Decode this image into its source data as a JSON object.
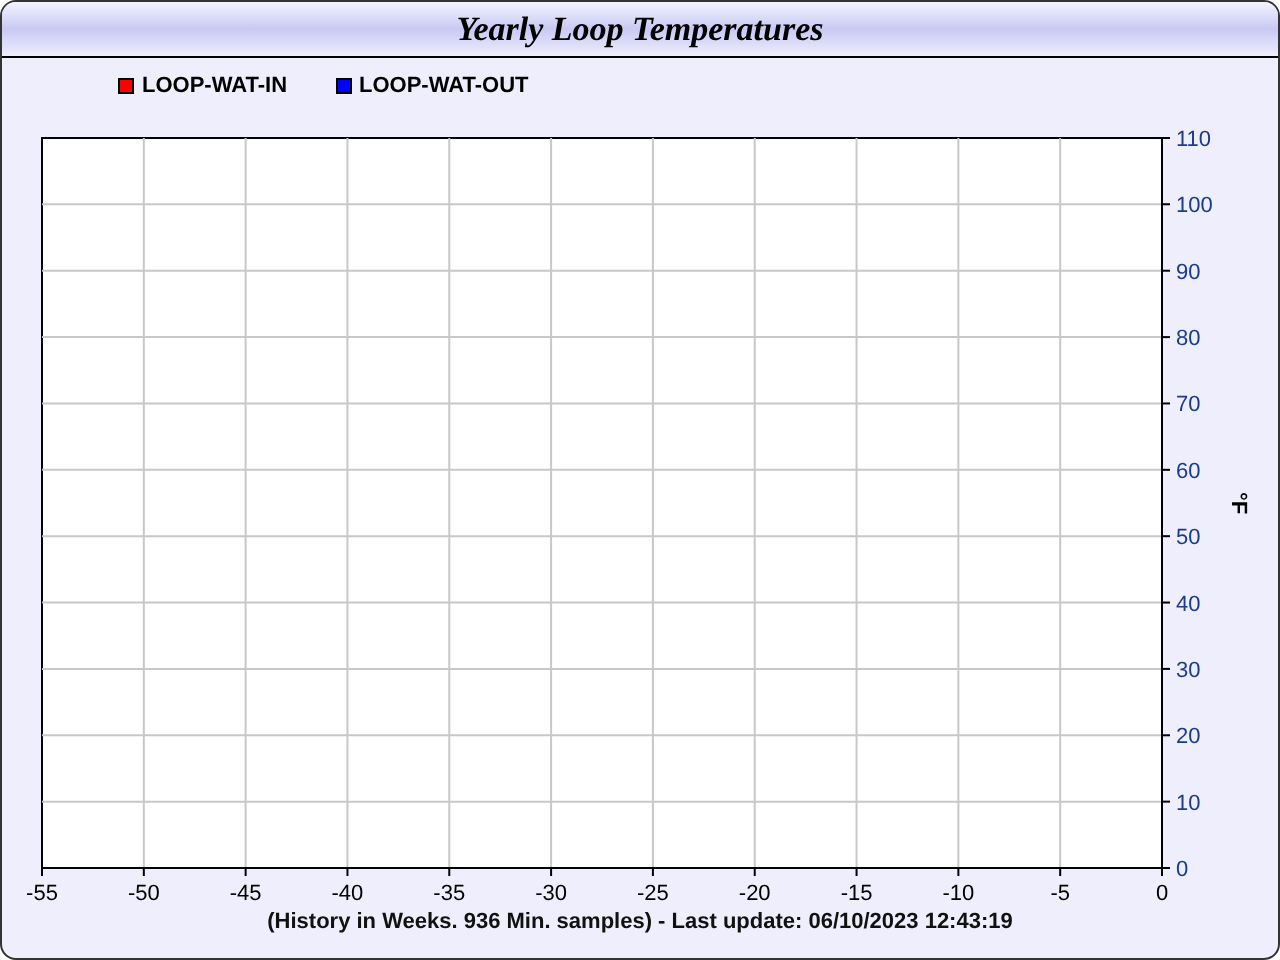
{
  "window": {
    "title": "Yearly Loop Temperatures"
  },
  "chart": {
    "chart_data": {
      "type": "line",
      "ylabel": "°F",
      "series": [
        {
          "name": "LOOP-WAT-IN",
          "color": "#ff0000",
          "values": [
            null,
            null,
            null,
            null,
            null,
            null,
            null,
            null,
            null,
            null,
            null,
            null
          ]
        },
        {
          "name": "LOOP-WAT-OUT",
          "color": "#0000ff",
          "values": [
            null,
            null,
            null,
            null,
            null,
            null,
            null,
            null,
            null,
            null,
            null,
            null
          ]
        }
      ],
      "categories": [
        "-55",
        "-50",
        "-45",
        "-40",
        "-35",
        "-30",
        "-25",
        "-20",
        "-15",
        "-10",
        "-5",
        "0"
      ],
      "ylim": [
        0,
        110
      ],
      "grid": true,
      "yticks": [
        0,
        10,
        20,
        30,
        40,
        50,
        60,
        70,
        80,
        90,
        100,
        110
      ]
    },
    "footer": "(History in Weeks. 936 Min. samples) - Last update: 06/10/2023 12:43:19"
  }
}
